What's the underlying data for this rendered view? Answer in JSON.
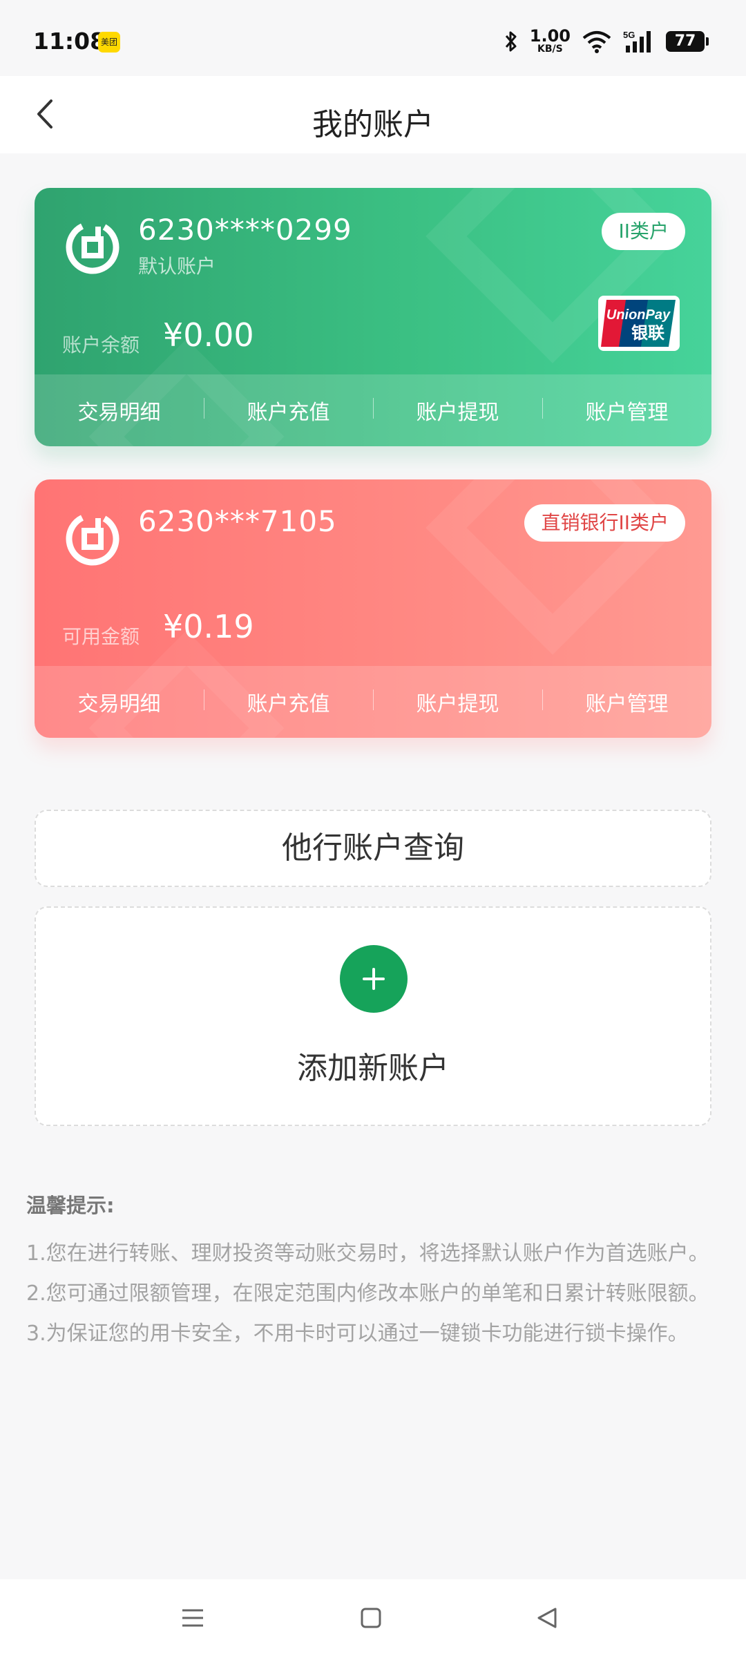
{
  "status": {
    "time": "11:08",
    "meituan": "美团",
    "speed_value": "1.00",
    "speed_unit": "KB/S",
    "network": "5G",
    "battery": "77"
  },
  "header": {
    "title": "我的账户"
  },
  "cards": [
    {
      "account_no": "6230****0299",
      "subtitle": "默认账户",
      "badge": "II类户",
      "balance_label": "账户余额",
      "balance": "¥0.00",
      "actions": [
        "交易明细",
        "账户充值",
        "账户提现",
        "账户管理"
      ]
    },
    {
      "account_no": "6230***7105",
      "subtitle": "",
      "badge": "直销银行II类户",
      "balance_label": "可用金额",
      "balance": "¥0.19",
      "actions": [
        "交易明细",
        "账户充值",
        "账户提现",
        "账户管理"
      ]
    }
  ],
  "query_box": {
    "label": "他行账户查询"
  },
  "add_box": {
    "label": "添加新账户"
  },
  "tips": {
    "title": "温馨提示:",
    "items": [
      "1.您在进行转账、理财投资等动账交易时，将选择默认账户作为首选账户。",
      "2.您可通过限额管理，在限定范围内修改本账户的单笔和日累计转账限额。",
      "3.为保证您的用卡安全，不用卡时可以通过一键锁卡功能进行锁卡操作。"
    ]
  },
  "unionpay": {
    "latin": "UnionPay",
    "chinese": "银联"
  },
  "colors": {
    "green": "#3bc083",
    "red": "#ff8a84",
    "accent": "#16a35a"
  }
}
